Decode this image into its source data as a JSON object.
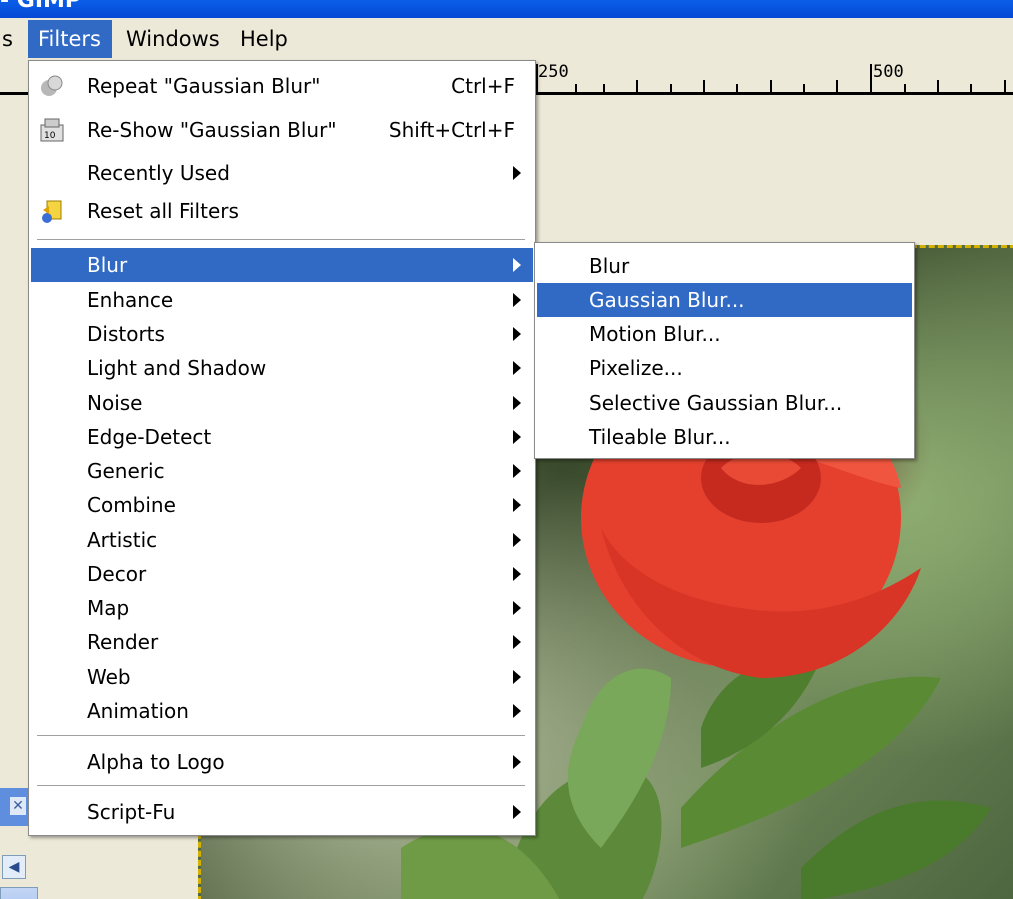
{
  "titlebar": {
    "text": "- GIMP"
  },
  "menubar": {
    "items": [
      {
        "label": "s"
      },
      {
        "label": "Filters"
      },
      {
        "label": "Windows"
      },
      {
        "label": "Help"
      }
    ]
  },
  "ruler": {
    "labels": [
      "250",
      "500"
    ]
  },
  "filters_menu": {
    "items": [
      {
        "label": "Repeat \"Gaussian Blur\"",
        "accel": "Ctrl+F",
        "icon": "repeat-icon"
      },
      {
        "label": "Re-Show \"Gaussian Blur\"",
        "accel": "Shift+Ctrl+F",
        "icon": "reshow-icon"
      },
      {
        "label": "Recently Used",
        "submenu": true
      },
      {
        "label": "Reset all Filters",
        "icon": "reset-icon"
      },
      {
        "label": "Blur",
        "submenu": true,
        "highlighted": true
      },
      {
        "label": "Enhance",
        "submenu": true
      },
      {
        "label": "Distorts",
        "submenu": true
      },
      {
        "label": "Light and Shadow",
        "submenu": true
      },
      {
        "label": "Noise",
        "submenu": true
      },
      {
        "label": "Edge-Detect",
        "submenu": true
      },
      {
        "label": "Generic",
        "submenu": true
      },
      {
        "label": "Combine",
        "submenu": true
      },
      {
        "label": "Artistic",
        "submenu": true
      },
      {
        "label": "Decor",
        "submenu": true
      },
      {
        "label": "Map",
        "submenu": true
      },
      {
        "label": "Render",
        "submenu": true
      },
      {
        "label": "Web",
        "submenu": true
      },
      {
        "label": "Animation",
        "submenu": true
      },
      {
        "label": "Alpha to Logo",
        "submenu": true
      },
      {
        "label": "Script-Fu",
        "submenu": true
      }
    ]
  },
  "blur_submenu": {
    "items": [
      {
        "label": "Blur"
      },
      {
        "label": "Gaussian Blur...",
        "highlighted": true
      },
      {
        "label": "Motion Blur..."
      },
      {
        "label": "Pixelize..."
      },
      {
        "label": "Selective Gaussian Blur..."
      },
      {
        "label": "Tileable Blur..."
      }
    ]
  },
  "colors": {
    "highlight": "#316ac5",
    "menu_bg": "#ffffff",
    "window_bg": "#ece9d8",
    "titlebar": "#0549d6"
  }
}
